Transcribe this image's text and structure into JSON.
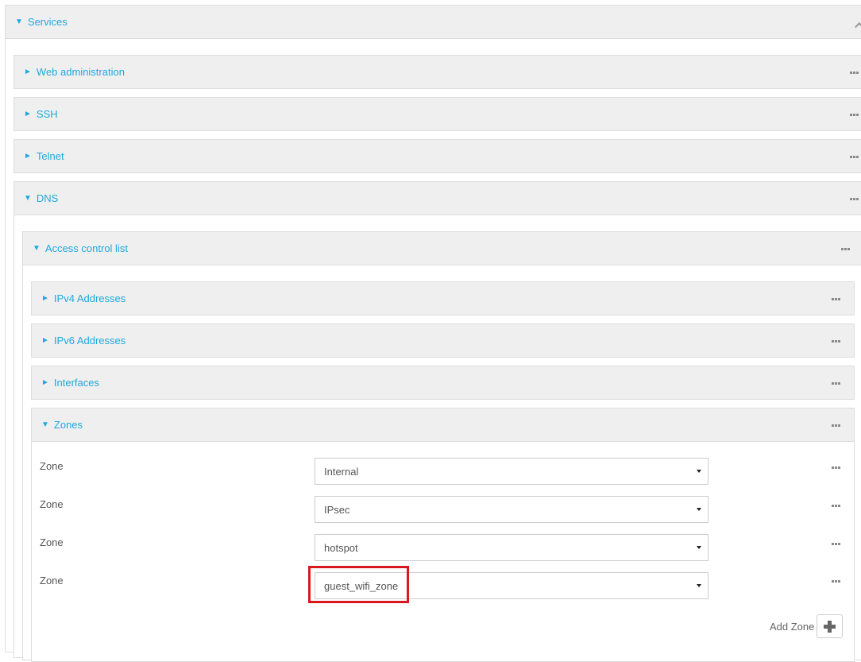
{
  "services": {
    "label": "Services",
    "arrow": "▼"
  },
  "sections": {
    "web_admin": {
      "label": "Web administration",
      "arrow": "►"
    },
    "ssh": {
      "label": "SSH",
      "arrow": "►"
    },
    "telnet": {
      "label": "Telnet",
      "arrow": "►"
    },
    "dns": {
      "label": "DNS",
      "arrow": "▼"
    }
  },
  "acl": {
    "label": "Access control list",
    "arrow": "▼",
    "ipv4": {
      "label": "IPv4 Addresses",
      "arrow": "►"
    },
    "ipv6": {
      "label": "IPv6 Addresses",
      "arrow": "►"
    },
    "interfaces": {
      "label": "Interfaces",
      "arrow": "►"
    },
    "zones": {
      "label": "Zones",
      "arrow": "▼",
      "rows": [
        {
          "label": "Zone",
          "value": "Internal"
        },
        {
          "label": "Zone",
          "value": "IPsec"
        },
        {
          "label": "Zone",
          "value": "hotspot"
        },
        {
          "label": "Zone",
          "value": "guest_wifi_zone"
        }
      ],
      "add_label": "Add Zone"
    }
  },
  "icons": {
    "menu": "ellipsis-icon",
    "add": "plus-icon",
    "dropdown": "caret-down-icon"
  },
  "colors": {
    "accent": "#1fa9dd",
    "highlight": "#d71920",
    "header_bg": "#efefef"
  }
}
